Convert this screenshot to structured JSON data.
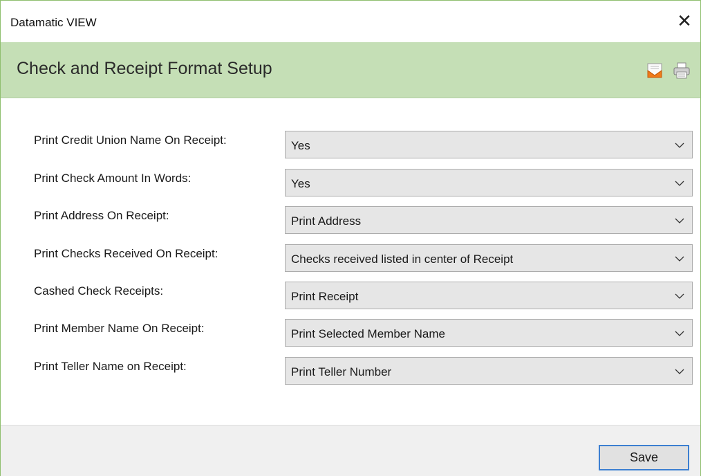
{
  "window": {
    "title": "Datamatic VIEW",
    "close_glyph": "✕"
  },
  "header": {
    "heading": "Check and Receipt Format Setup",
    "icons": [
      "email-icon",
      "print-icon"
    ]
  },
  "fields": [
    {
      "label": "Print Credit Union Name On Receipt:",
      "value": "Yes"
    },
    {
      "label": "Print Check Amount In Words:",
      "value": "Yes"
    },
    {
      "label": "Print Address On Receipt:",
      "value": "Print Address"
    },
    {
      "label": "Print Checks Received On Receipt:",
      "value": "Checks received listed in center of Receipt"
    },
    {
      "label": "Cashed Check Receipts:",
      "value": "Print Receipt"
    },
    {
      "label": "Print Member Name On Receipt:",
      "value": "Print Selected Member Name"
    },
    {
      "label": "Print Teller Name on Receipt:",
      "value": "Print Teller Number"
    }
  ],
  "footer": {
    "save_label": "Save"
  },
  "colors": {
    "header_bg": "#c5dfb6",
    "accent_border": "#3c7fd1",
    "select_bg": "#e6e6e6"
  }
}
